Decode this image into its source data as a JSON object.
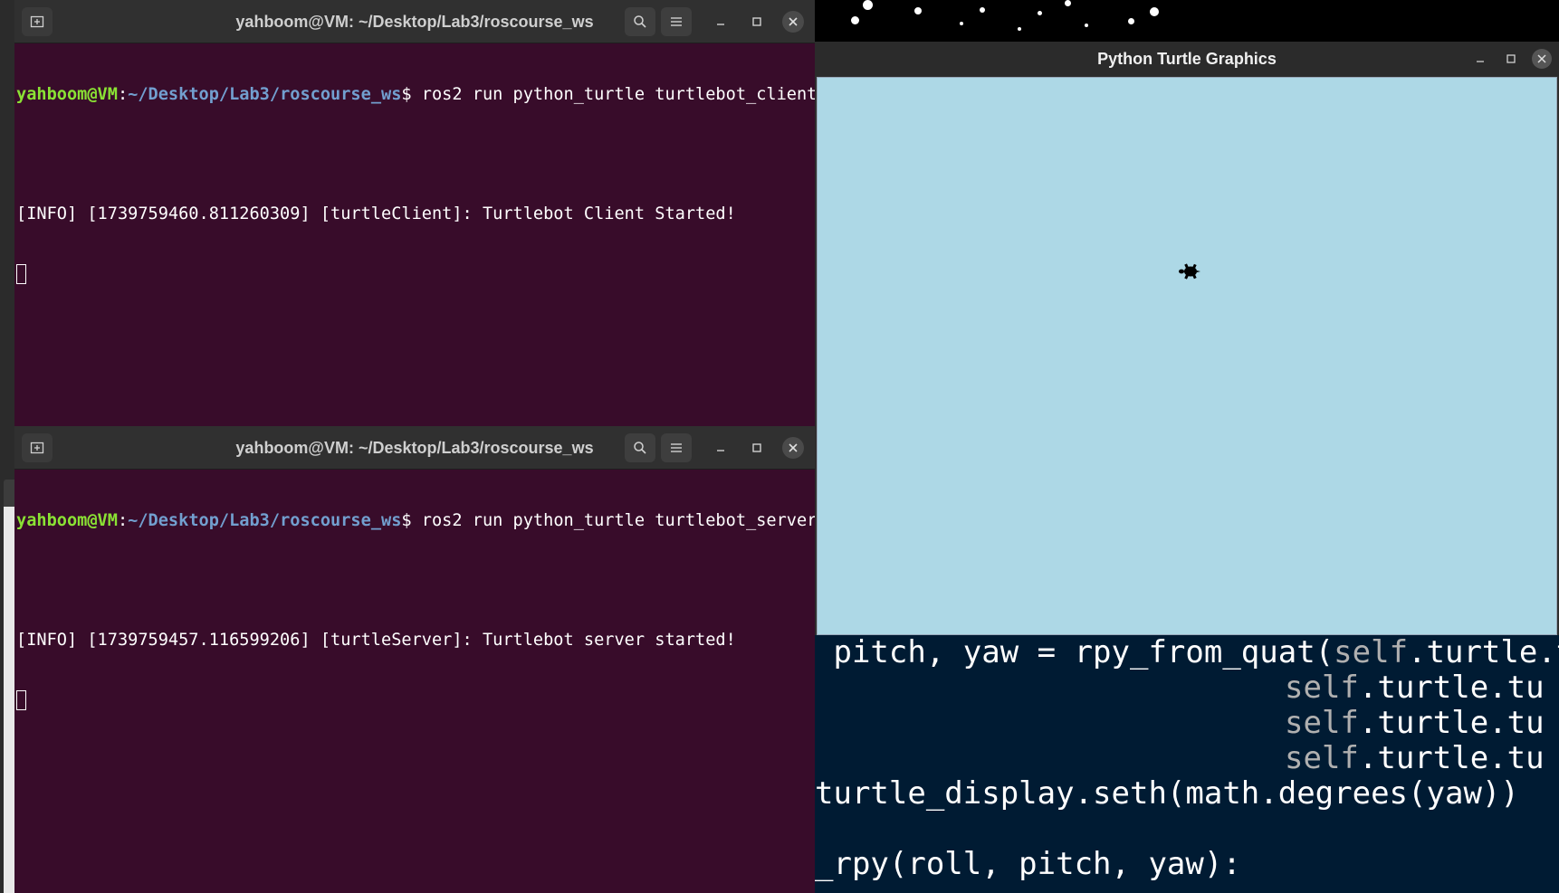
{
  "desktop": {
    "bg": "#000000"
  },
  "terminal_top": {
    "title": "yahboom@VM: ~/Desktop/Lab3/roscourse_ws",
    "prompt_user": "yahboom@VM",
    "prompt_sep": ":",
    "prompt_path": "~/Desktop/Lab3/roscourse_ws",
    "prompt_symbol": "$ ",
    "command": "ros2 run python_turtle turtlebot_client",
    "output": "[INFO] [1739759460.811260309] [turtleClient]: Turtlebot Client Started!",
    "bg": "#380c2a"
  },
  "terminal_bottom": {
    "title": "yahboom@VM: ~/Desktop/Lab3/roscourse_ws",
    "prompt_user": "yahboom@VM",
    "prompt_sep": ":",
    "prompt_path": "~/Desktop/Lab3/roscourse_ws",
    "prompt_symbol": "$ ",
    "command": "ros2 run python_turtle turtlebot_server",
    "output": "[INFO] [1739759457.116599206] [turtleServer]: Turtlebot server started!",
    "bg": "#380c2a"
  },
  "terminal_icons": {
    "new_tab": "new-tab-icon",
    "search": "search-icon",
    "menu": "hamburger-menu-icon",
    "minimize": "minimize-icon",
    "maximize": "maximize-icon",
    "close": "close-icon"
  },
  "turtle_window": {
    "title": "Python Turtle Graphics",
    "canvas_color": "#add8e6"
  },
  "code_editor": {
    "lines": [
      " pitch, yaw = rpy_from_quat(",
      "self",
      ".turtle.t",
      "self",
      ".turtle.tu",
      "self",
      ".turtle.tu",
      "self",
      ".turtle.tu",
      "turtle_display.seth(math.degrees(yaw))",
      "_rpy(roll, pitch, yaw):"
    ],
    "bg": "#001b33"
  }
}
